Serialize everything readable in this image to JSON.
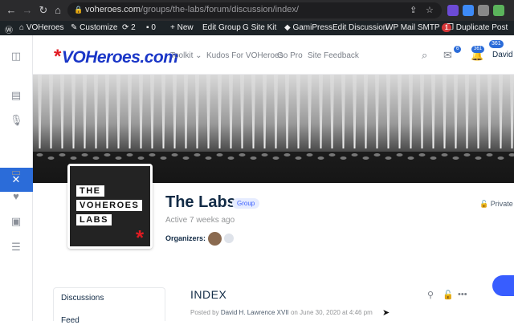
{
  "browser": {
    "url_host": "voheroes.com",
    "url_path": "/groups/the-labs/forum/discussion/index/"
  },
  "adminbar": {
    "items": [
      "VOHeroes",
      "Customize",
      "2",
      "0",
      "New",
      "Edit Group",
      "Site Kit",
      "GamiPress",
      "Edit Discussion",
      "WP Mail SMTP",
      "Duplicate Post"
    ],
    "smtp_badge": "1"
  },
  "header": {
    "logo": "VOHeroes.com",
    "menu": [
      "Toolkit",
      "Kudos For VOHeroes",
      "Go Pro",
      "Site Feedback"
    ],
    "user_name": "David H",
    "messages_badge": "6",
    "notifications_badge": "361",
    "points_badge": "361"
  },
  "group": {
    "avatar_lines": [
      "THE",
      "VOHEROES",
      "LABS"
    ],
    "title": "The Labs",
    "type_badge": "Group",
    "active": "Active 7 weeks ago",
    "organizers_label": "Organizers:",
    "privacy": "Private"
  },
  "sidebar": {
    "items": [
      "Discussions",
      "Feed"
    ]
  },
  "discussion": {
    "title": "INDEX",
    "posted_by_prefix": "Posted by",
    "author": "David H. Lawrence XVII",
    "date_text": "on June 30, 2020 at 4:46 pm"
  },
  "colors": {
    "accent": "#2b6cd9",
    "logo_blue": "#1a36c7",
    "logo_red": "#e11b22"
  }
}
